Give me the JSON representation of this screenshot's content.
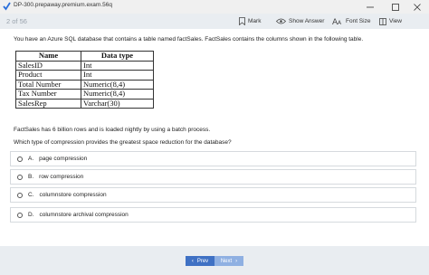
{
  "window": {
    "title": "DP-300.prepaway.premium.exam.56q"
  },
  "toolbar": {
    "counter": "2 of 56",
    "mark": "Mark",
    "show_answer": "Show Answer",
    "font_size": "Font Size",
    "view": "View"
  },
  "question": {
    "intro": "You have an Azure SQL database that contains a table named factSales. FactSales contains the columns shown in the following table.",
    "table_headers": [
      "Name",
      "Data type"
    ],
    "table_rows": [
      [
        "SalesID",
        "Int"
      ],
      [
        "Product",
        "Int"
      ],
      [
        "Total Number",
        "Numeric(8,4)"
      ],
      [
        "Tax Number",
        "Numeric(8,4)"
      ],
      [
        "SalesRep",
        "Varchar(30)"
      ]
    ],
    "detail": "FactSales has 6 billion rows and is loaded nightly by using a batch process.",
    "prompt": "Which type of compression provides the greatest space reduction for the database?"
  },
  "options": [
    {
      "letter": "A.",
      "text": "page compression"
    },
    {
      "letter": "B.",
      "text": "row compression"
    },
    {
      "letter": "C.",
      "text": "columnstore compression"
    },
    {
      "letter": "D.",
      "text": "columnstore archival compression"
    }
  ],
  "footer": {
    "prev": "Prev",
    "next": "Next"
  },
  "colors": {
    "accent": "#3f71c4",
    "toolbar_bg": "#e9edf1"
  }
}
